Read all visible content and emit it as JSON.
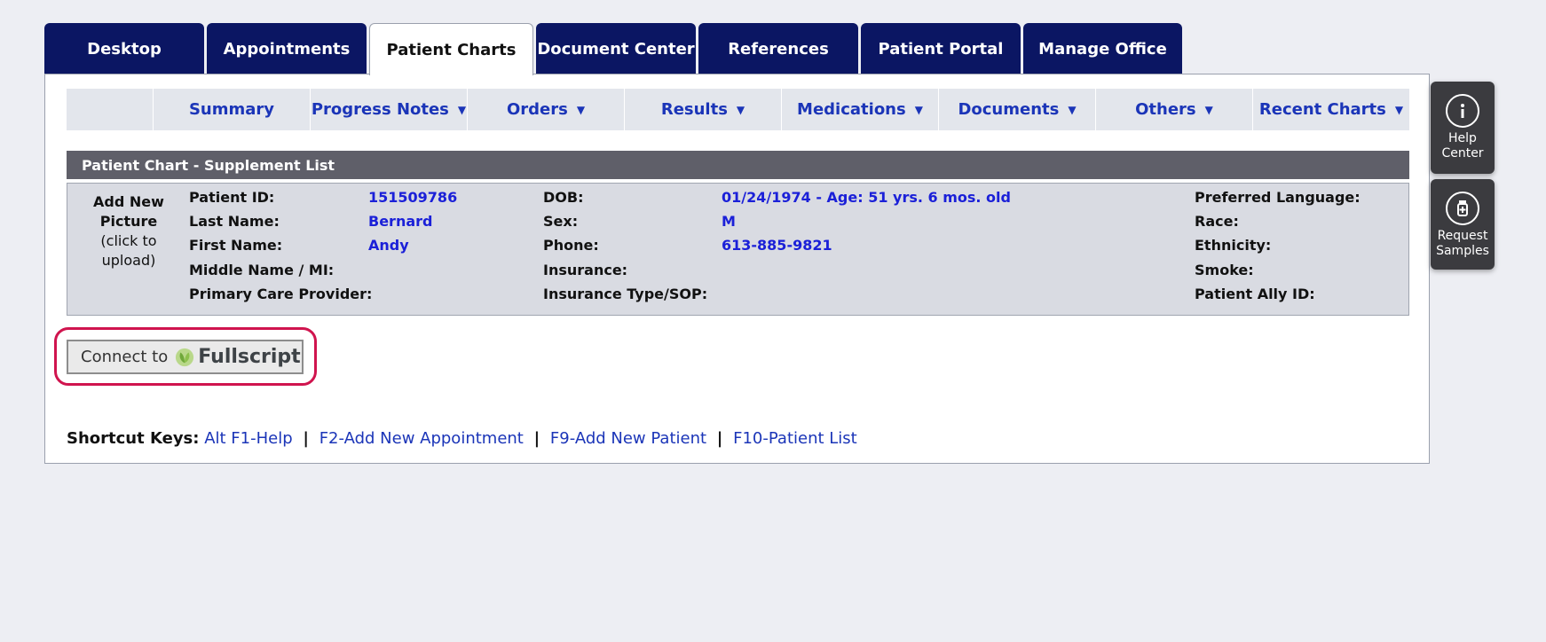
{
  "main_tabs": [
    {
      "label": "Desktop"
    },
    {
      "label": "Appointments"
    },
    {
      "label": "Patient Charts"
    },
    {
      "label": "Document Center"
    },
    {
      "label": "References"
    },
    {
      "label": "Patient Portal"
    },
    {
      "label": "Manage Office"
    }
  ],
  "active_tab": "Patient Charts",
  "sub_nav": [
    {
      "label": "Summary"
    },
    {
      "label": "Progress Notes"
    },
    {
      "label": "Orders"
    },
    {
      "label": "Results"
    },
    {
      "label": "Medications"
    },
    {
      "label": "Documents"
    },
    {
      "label": "Others"
    },
    {
      "label": "Recent Charts"
    }
  ],
  "section_title": "Patient Chart - Supplement List",
  "picture": {
    "line1": "Add New",
    "line2": "Picture",
    "line3": "(click to",
    "line4": "upload)"
  },
  "patient": {
    "patient_id_label": "Patient ID:",
    "patient_id": "151509786",
    "last_name_label": "Last Name:",
    "last_name": "Bernard",
    "first_name_label": "First Name:",
    "first_name": "Andy",
    "middle_name_label": "Middle Name / MI:",
    "pcp_label": "Primary Care Provider:",
    "dob_label": "DOB:",
    "dob": "01/24/1974 - Age: 51 yrs. 6 mos. old",
    "sex_label": "Sex:",
    "sex": "M",
    "phone_label": "Phone:",
    "phone": "613-885-9821",
    "insurance_label": "Insurance:",
    "insurance_type_label": "Insurance Type/SOP:",
    "language_label": "Preferred Language:",
    "race_label": "Race:",
    "ethnicity_label": "Ethnicity:",
    "smoke_label": "Smoke:",
    "ally_label": "Patient Ally ID:"
  },
  "connect_button": {
    "prefix": "Connect to",
    "brand": "Fullscript"
  },
  "shortcuts": {
    "label": "Shortcut Keys:",
    "items": [
      "Alt F1-Help",
      "F2-Add New Appointment",
      "F9-Add New Patient",
      "F10-Patient List"
    ],
    "separator": "|"
  },
  "side_widgets": {
    "help_line1": "Help",
    "help_line2": "Center",
    "samples_line1": "Request",
    "samples_line2": "Samples"
  },
  "colors": {
    "nav_blue": "#0b1663",
    "link_blue": "#1b35b8",
    "value_blue": "#1b20d8",
    "highlight": "#d0144e"
  }
}
